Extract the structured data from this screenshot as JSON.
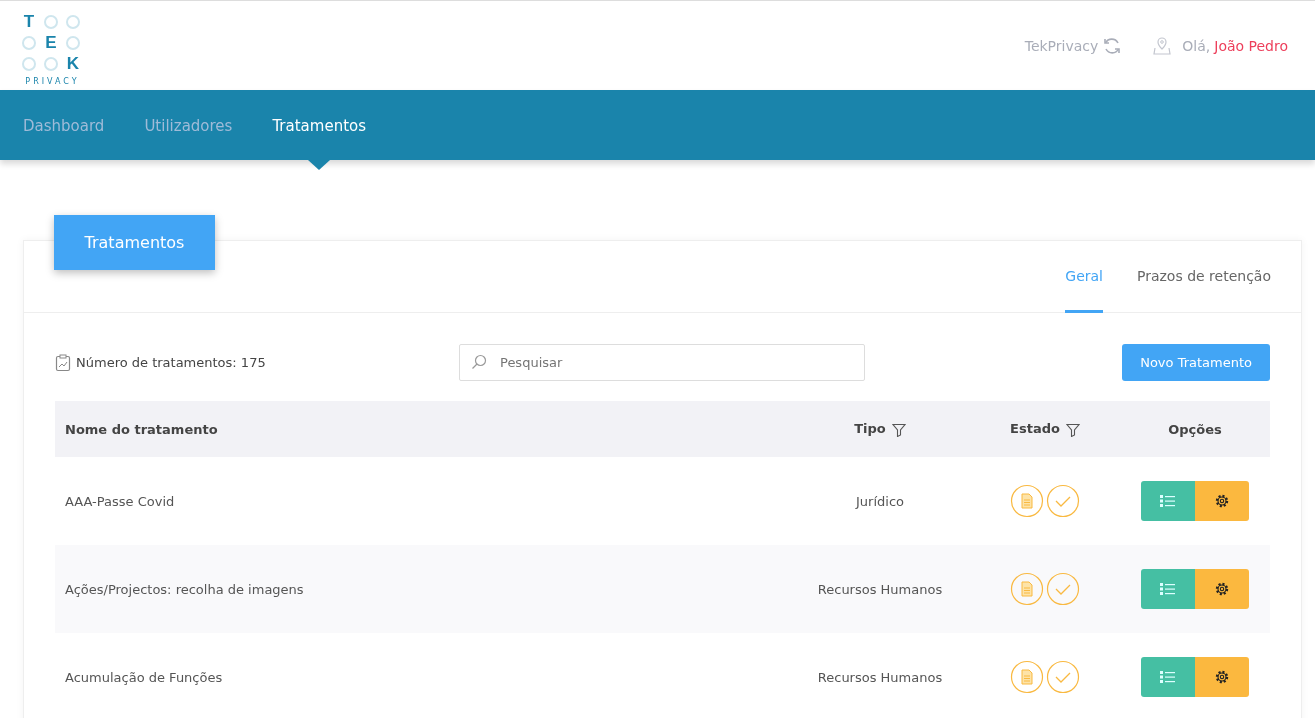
{
  "logo": {
    "letters": [
      "T",
      "E",
      "K"
    ],
    "subtitle": "PRIVACY"
  },
  "header": {
    "app_name": "TekPrivacy",
    "greeting": "Olá,",
    "user": "João Pedro"
  },
  "nav": [
    {
      "label": "Dashboard",
      "selected": false
    },
    {
      "label": "Utilizadores",
      "selected": false
    },
    {
      "label": "Tratamentos",
      "selected": true
    }
  ],
  "card": {
    "title": "Tratamentos",
    "tabs": [
      {
        "label": "Geral",
        "selected": true
      },
      {
        "label": "Prazos de retenção",
        "selected": false
      }
    ],
    "count": "Número de tratamentos: 175",
    "search": {
      "placeholder": "Pesquisar"
    },
    "new_button": "Novo Tratamento",
    "table": {
      "columns": [
        "Nome do tratamento",
        "Tipo",
        "Estado",
        "Opções"
      ],
      "rows": [
        {
          "name": "AAA-Passe Covid",
          "type": "Jurídico"
        },
        {
          "name": "Ações/Projectos: recolha de imagens",
          "type": "Recursos Humanos"
        },
        {
          "name": "Acumulação de Funções",
          "type": "Recursos Humanos"
        }
      ]
    }
  }
}
